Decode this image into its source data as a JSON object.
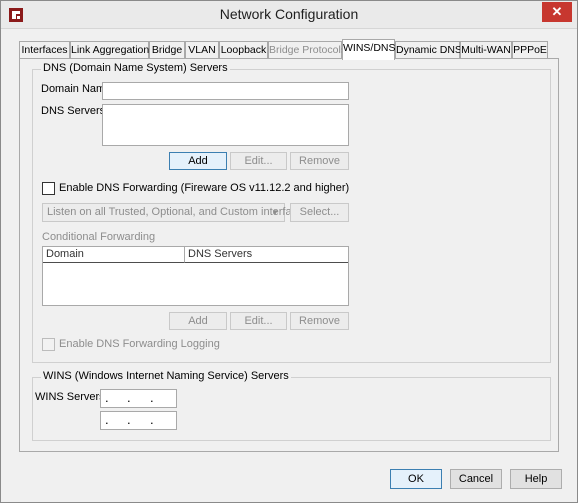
{
  "window": {
    "title": "Network Configuration",
    "close_glyph": "✕"
  },
  "tabs": [
    {
      "label": "Interfaces",
      "state": "normal"
    },
    {
      "label": "Link Aggregation",
      "state": "normal"
    },
    {
      "label": "Bridge",
      "state": "normal"
    },
    {
      "label": "VLAN",
      "state": "normal"
    },
    {
      "label": "Loopback",
      "state": "normal"
    },
    {
      "label": "Bridge Protocols",
      "state": "disabled"
    },
    {
      "label": "WINS/DNS",
      "state": "active"
    },
    {
      "label": "Dynamic DNS",
      "state": "normal"
    },
    {
      "label": "Multi-WAN",
      "state": "normal"
    },
    {
      "label": "PPPoE",
      "state": "normal"
    }
  ],
  "dns": {
    "legend": "DNS (Domain Name System) Servers",
    "domain_name_label": "Domain Name:",
    "domain_name_value": "",
    "dns_servers_label": "DNS Servers:",
    "add_label": "Add",
    "edit_label": "Edit...",
    "remove_label": "Remove",
    "forwarding_checkbox_label": "Enable DNS Forwarding (Fireware OS v11.12.2 and higher)",
    "forwarding_checked": false,
    "listen_select_value": "Listen on all Trusted, Optional, and Custom interfaces",
    "select_label": "Select...",
    "conditional_label": "Conditional Forwarding",
    "table_headers": [
      "Domain",
      "DNS Servers"
    ],
    "cf_add_label": "Add",
    "cf_edit_label": "Edit...",
    "cf_remove_label": "Remove",
    "logging_checkbox_label": "Enable DNS Forwarding Logging",
    "logging_checked": false
  },
  "wins": {
    "legend": "WINS (Windows Internet Naming Service) Servers",
    "servers_label": "WINS Servers:",
    "ip_dot": "."
  },
  "footer": {
    "ok_label": "OK",
    "cancel_label": "Cancel",
    "help_label": "Help"
  },
  "colors": {
    "close_button": "#c7372f",
    "default_button_border": "#3c7fb1"
  }
}
